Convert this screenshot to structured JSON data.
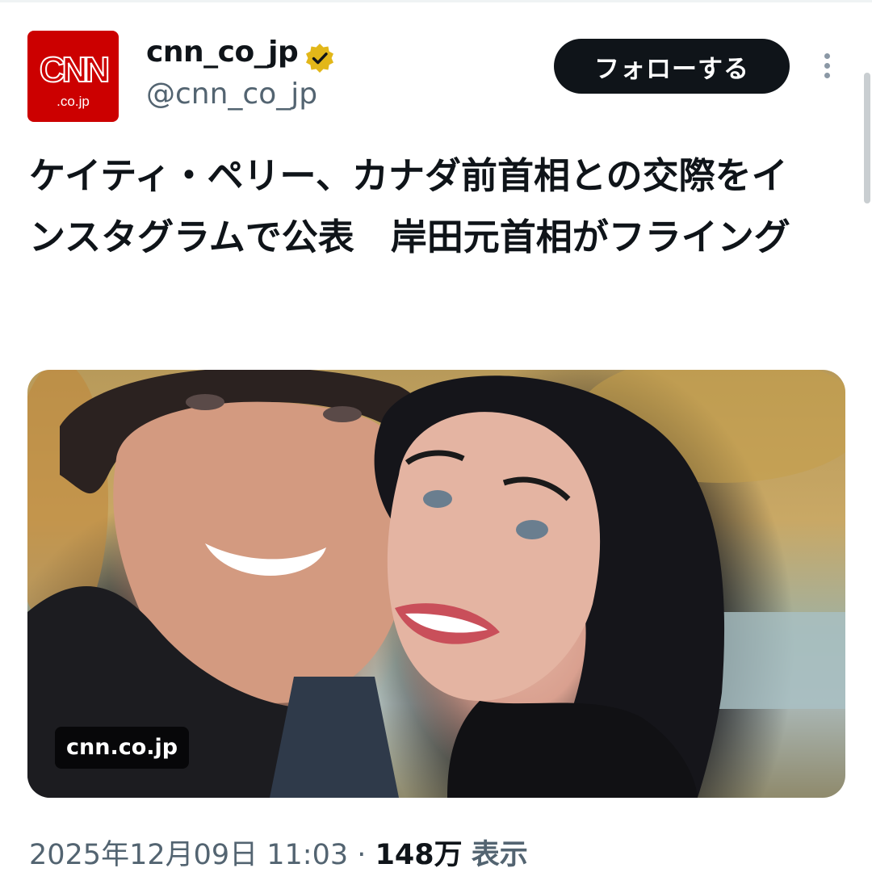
{
  "author": {
    "avatar_brand": "CNN",
    "avatar_sub": ".co.jp",
    "display_name": "cnn_co_jp",
    "handle": "@cnn_co_jp",
    "verified": true,
    "verified_color": "#e2b719"
  },
  "actions": {
    "follow_label": "フォローする"
  },
  "post": {
    "headline": "ケイティ・ペリー、カナダ前首相との交際をインスタグラムで公表　岸田元首相がフライング",
    "media_source_label": "cnn.co.jp"
  },
  "meta": {
    "timestamp": "2025年12月09日 11:03",
    "separator": "·",
    "views_count": "148万",
    "views_label": "表示"
  },
  "icons": [
    "verified-badge-icon",
    "more-options-icon"
  ],
  "colors": {
    "brand_red": "#cc0000",
    "follow_button": "#0f1419",
    "secondary_text": "#536471"
  }
}
